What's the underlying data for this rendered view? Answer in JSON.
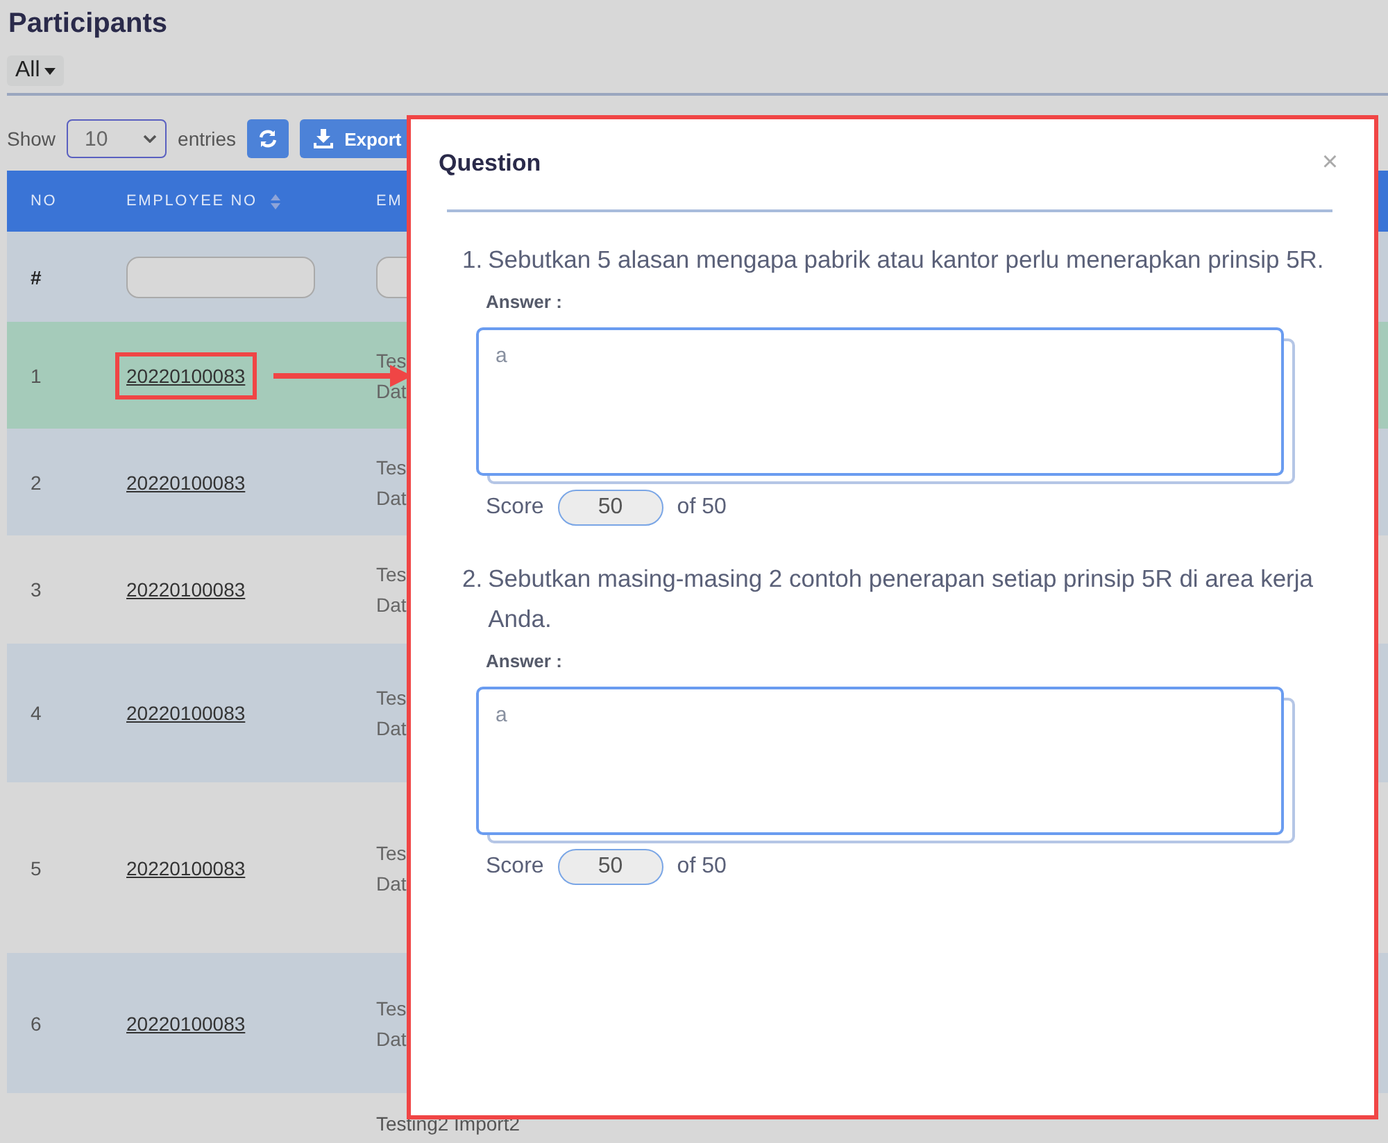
{
  "page": {
    "title": "Participants",
    "filter": "All"
  },
  "toolbar": {
    "show_label": "Show",
    "page_size": "10",
    "entries_label": "entries",
    "export_label": "Export"
  },
  "table": {
    "columns": [
      "NO",
      "EMPLOYEE NO",
      "EM"
    ],
    "filter_row_label": "#",
    "rows": [
      {
        "no": "1",
        "employee_no": "20220100083",
        "column_3": [
          "Tes",
          "Dat"
        ],
        "selected": true,
        "highlighted": true
      },
      {
        "no": "2",
        "employee_no": "20220100083",
        "column_3": [
          "Tes",
          "Dat"
        ],
        "selected": false,
        "highlighted": false
      },
      {
        "no": "3",
        "employee_no": "20220100083",
        "column_3": [
          "Tes",
          "Dat"
        ],
        "selected": false,
        "highlighted": false
      },
      {
        "no": "4",
        "employee_no": "20220100083",
        "column_3": [
          "Tes",
          "Dat"
        ],
        "selected": false,
        "highlighted": false
      },
      {
        "no": "5",
        "employee_no": "20220100083",
        "column_3": [
          "Tes",
          "Dat"
        ],
        "selected": false,
        "highlighted": false
      },
      {
        "no": "6",
        "employee_no": "20220100083",
        "column_3": [
          "Tes",
          "Dat"
        ],
        "selected": false,
        "highlighted": false
      }
    ],
    "partial_row": "Testing2 Import2"
  },
  "modal": {
    "title": "Question",
    "close": "×",
    "questions": [
      {
        "number": "1.",
        "text": "Sebutkan 5 alasan mengapa pabrik atau kantor perlu menerapkan prinsip 5R.",
        "answer_label": "Answer :",
        "answer": "a",
        "score_label": "Score",
        "score": "50",
        "max": "of 50"
      },
      {
        "number": "2.",
        "text": "Sebutkan masing-masing 2 contoh penerapan setiap prinsip 5R di area kerja Anda.",
        "answer_label": "Answer :",
        "answer": "a",
        "score_label": "Score",
        "score": "50",
        "max": "of 50"
      }
    ]
  }
}
